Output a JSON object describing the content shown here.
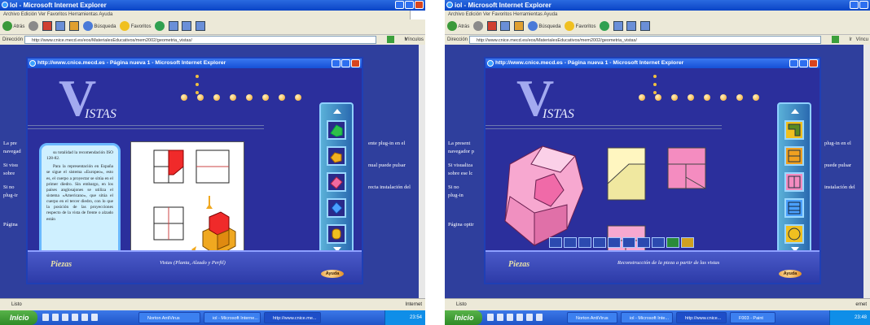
{
  "left": {
    "window_title": "Iol - Microsoft Internet Explorer",
    "menu": "Archivo   Edición   Ver   Favoritos   Herramientas   Ayuda",
    "toolbar": {
      "back": "Atrás",
      "search": "Búsqueda",
      "favorites": "Favoritos"
    },
    "address_label": "Dirección",
    "address": "http://www.cnice.mecd.es/eos/MaterialesEducativos/mem2002/geometria_vistas/",
    "go_label": "Ir",
    "links_label": "Vínculos",
    "page_text_left": [
      "La pre",
      "navegad",
      "Si visu",
      "sobre",
      "Si no",
      "plug-ir",
      "Página"
    ],
    "page_text_right": [
      "ente plug-in en el",
      "nual puede pulsar",
      "recta instalación del"
    ],
    "inner_title": "http://www.cnice.mecd.es - Página nueva 1 - Microsoft Internet Explorer",
    "logo_word": "ISTAS",
    "text_paragraphs": [
      "su totalidad la recomendación ISO 128-82.",
      "Para la representación en España se sigue el sistema «Europeo», esto es, el cuerpo a proyectar se sitúa en el primer diedro. Sin embargo, en los países anglosajones se utiliza el sistema «Americano», que sitúa el cuerpo en el tercer diedro, con lo que la posición de las proyecciones respecto de la vista de frente o alzado están"
    ],
    "text_nav": [
      "↕ ∧",
      "∨"
    ],
    "footer_left": "Piezas",
    "footer_mid": "Vistas (Planta, Alzado y Perfil)",
    "help_button": "Ayuda",
    "status": "Listo",
    "status_right": "Internet",
    "start": "Inicio",
    "tasks": [
      "Norton AntiVirus",
      "iol - Microsoft Interne...",
      "http://www.cnice.me..."
    ],
    "clock": "23:54"
  },
  "right": {
    "window_title": "iol - Microsoft Internet Explorer",
    "menu": "Archivo   Edición   Ver   Favoritos   Herramientas   Ayuda",
    "toolbar": {
      "back": "Atrás",
      "search": "Búsqueda",
      "favorites": "Favoritos"
    },
    "address_label": "Dirección",
    "address": "http://www.cnice.mecd.es/eos/MaterialesEducativos/mem2002/geometria_vistas/",
    "go_label": "Ir",
    "links_label": "Víncu",
    "page_text_left": [
      "La present",
      "navegador p",
      "Si visualiza",
      "sobre ese lc",
      "Si no",
      "plug-in",
      "Página optir"
    ],
    "page_text_right": [
      "plug-in en el",
      "puede pulsar",
      "instalación del"
    ],
    "inner_title": "http://www.cnice.mecd.es - Página nueva 1 - Microsoft Internet Explorer",
    "logo_word": "ISTAS",
    "footer_left": "Piezas",
    "footer_mid": "Reconstrucción de la pieza a partir de las vistas",
    "help_button": "Ayuda",
    "status": "Listo",
    "status_right": "ernet",
    "start": "Inicio",
    "tasks": [
      "Norton AntiVirus",
      "iol - Microsoft Inte...",
      "http://www.cnice...",
      "F003 - Paint"
    ],
    "clock": "23:48"
  }
}
